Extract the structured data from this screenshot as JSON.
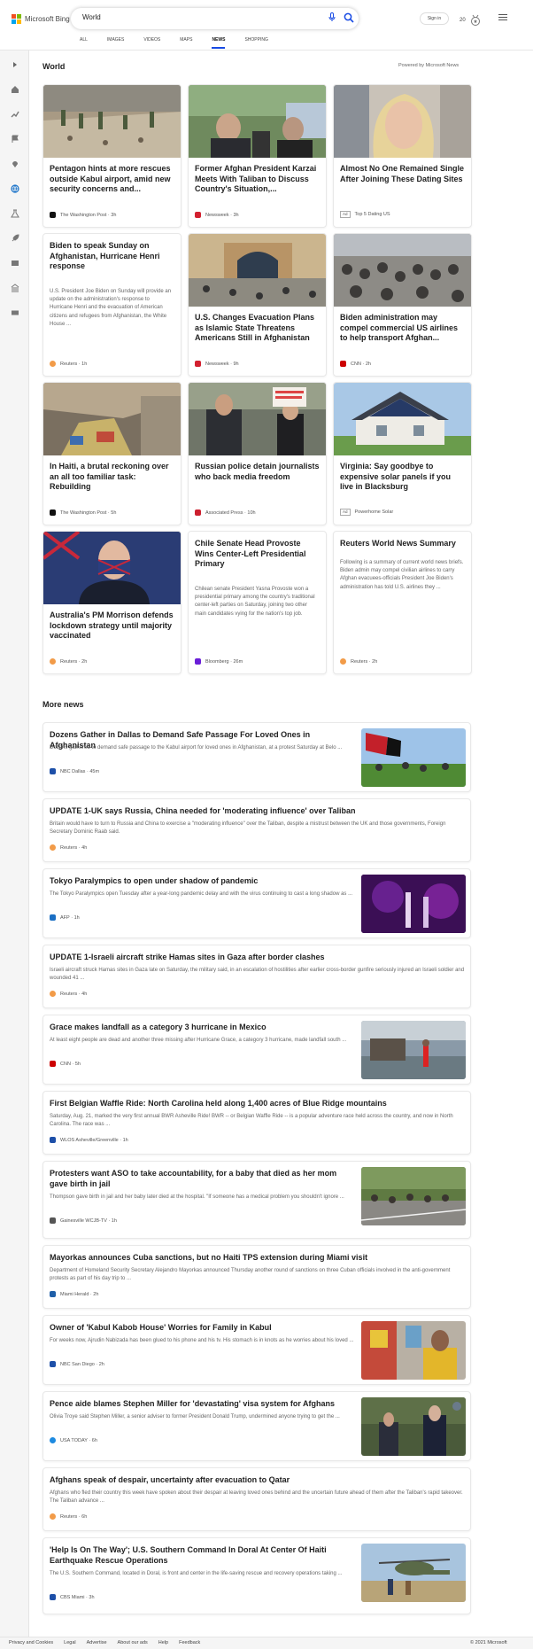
{
  "header": {
    "logo": "Microsoft Bing",
    "query": "World",
    "sign_in": "Sign in",
    "rewards": "20"
  },
  "tabs": [
    "ALL",
    "IMAGES",
    "VIDEOS",
    "MAPS",
    "NEWS",
    "SHOPPING"
  ],
  "section": {
    "title": "World",
    "powered": "Powered by Microsoft News"
  },
  "cards": [
    {
      "title": "Pentagon hints at more rescues outside Kabul airport, amid new security concerns and...",
      "source": "The Washington Post",
      "time": "3h"
    },
    {
      "title": "Former Afghan President Karzai Meets With Taliban to Discuss Country's Situation,...",
      "source": "Newsweek",
      "time": "3h"
    },
    {
      "title": "Almost No One Remained Single After Joining These Dating Sites",
      "ad": "Ad",
      "source": "Top 5 Dating US"
    },
    {
      "title": "Biden to speak Sunday on Afghanistan, Hurricane Henri response",
      "desc": "U.S. President Joe Biden on Sunday will provide an update on the administration's response to Hurricane Henri and the evacuation of American citizens and refugees from Afghanistan, the White House ...",
      "source": "Reuters",
      "time": "1h"
    },
    {
      "title": "U.S. Changes Evacuation Plans as Islamic State Threatens Americans Still in Afghanistan",
      "source": "Newsweek",
      "time": "9h"
    },
    {
      "title": "Biden administration may compel commercial US airlines to help transport Afghan...",
      "source": "CNN",
      "time": "2h"
    },
    {
      "title": "In Haiti, a brutal reckoning over an all too familiar task: Rebuilding",
      "source": "The Washington Post",
      "time": "5h"
    },
    {
      "title": "Russian police detain journalists who back media freedom",
      "source": "Associated Press",
      "time": "10h"
    },
    {
      "title": "Virginia: Say goodbye to expensive solar panels if you live in Blacksburg",
      "ad": "Ad",
      "source": "Powerhome Solar"
    },
    {
      "title": "Australia's PM Morrison defends lockdown strategy until majority vaccinated",
      "source": "Reuters",
      "time": "2h"
    },
    {
      "title": "Chile Senate Head Provoste Wins Center-Left Presidential Primary",
      "desc": "Chilean senate President Yasna Provoste won a presidential primary among the country's traditional center-left parties on Saturday, joining two other main candidates vying for the nation's top job.",
      "source": "Bloomberg",
      "time": "26m"
    },
    {
      "title": "Reuters World News Summary",
      "desc": "Following is a summary of current world news briefs. Biden admin may compel civilian airlines to carry Afghan evacuees-officials President Joe Biden's administration has told U.S. airlines they ...",
      "source": "Reuters",
      "time": "2h"
    }
  ],
  "more_title": "More news",
  "more": [
    {
      "title": "Dozens Gather in Dallas to Demand Safe Passage For Loved Ones in Afghanistan",
      "desc": "Dozens gathered to demand safe passage to the Kabul airport for loved ones in Afghanistan, at a protest Saturday at Belo ...",
      "source": "NBC Dallas",
      "time": "45m"
    },
    {
      "title": "UPDATE 1-UK says Russia, China needed for 'moderating influence' over Taliban",
      "desc": "Britain would have to turn to Russia and China to exercise a \"moderating influence\" over the Taliban, despite a mistrust between the UK and those governments, Foreign Secretary Dominic Raab said.",
      "source": "Reuters",
      "time": "4h"
    },
    {
      "title": "Tokyo Paralympics to open under shadow of pandemic",
      "desc": "The Tokyo Paralympics open Tuesday after a year-long pandemic delay and with the virus continuing to cast a long shadow as ...",
      "source": "AFP",
      "time": "1h"
    },
    {
      "title": "UPDATE 1-Israeli aircraft strike Hamas sites in Gaza after border clashes",
      "desc": "Israeli aircraft struck Hamas sites in Gaza late on Saturday, the military said, in an escalation of hostilities after earlier cross-border gunfire seriously injured an Israeli soldier and wounded 41 ...",
      "source": "Reuters",
      "time": "4h"
    },
    {
      "title": "Grace makes landfall as a category 3 hurricane in Mexico",
      "desc": "At least eight people are dead and another three missing after Hurricane Grace, a category 3 hurricane, made landfall south ...",
      "source": "CNN",
      "time": "5h"
    },
    {
      "title": "First Belgian Waffle Ride: North Carolina held along 1,400 acres of Blue Ridge mountains",
      "desc": "Saturday, Aug. 21, marked the very first annual BWR Asheville Ride! BWR -- or Belgian Waffle Ride -- is a popular adventure race held across the country, and now in North Carolina. The race was ...",
      "source": "WLOS Asheville/Greenville",
      "time": "1h"
    },
    {
      "title": "Protesters want ASO to take accountability, for a baby that died as her mom gave birth in jail",
      "desc": "Thompson gave birth in jail and her baby later died at the hospital. \"If someone has a medical problem you shouldn't ignore ...",
      "source": "Gainesville WCJB-TV",
      "time": "1h"
    },
    {
      "title": "Mayorkas announces Cuba sanctions, but no Haiti TPS extension during Miami visit",
      "desc": "Department of Homeland Security Secretary Alejandro Mayorkas announced Thursday another round of sanctions on three Cuban officials involved in the anti-government protests as part of his day trip to ...",
      "source": "Miami Herald",
      "time": "2h"
    },
    {
      "title": "Owner of 'Kabul Kabob House' Worries for Family in Kabul",
      "desc": "For weeks now, Ajrudin Nabizada has been glued to his phone and his tv. His stomach is in knots as he worries about his loved ...",
      "source": "NBC San Diego",
      "time": "2h"
    },
    {
      "title": "Pence aide blames Stephen Miller for 'devastating' visa system for Afghans",
      "desc": "Olivia Troye said Stephen Miller, a senior adviser to former President Donald Trump, undermined anyone trying to get the ...",
      "source": "USA TODAY",
      "time": "6h"
    },
    {
      "title": "Afghans speak of despair, uncertainty after evacuation to Qatar",
      "desc": "Afghans who fled their country this week have spoken about their despair at leaving loved ones behind and the uncertain future ahead of them after the Taliban's rapid takeover. The Taliban advance ...",
      "source": "Reuters",
      "time": "6h"
    },
    {
      "title": "'Help Is On The Way'; U.S. Southern Command In Doral At Center Of Haiti Earthquake Rescue Operations",
      "desc": "The U.S. Southern Command, located in Doral, is front and center in the life-saving rescue and recovery operations taking ...",
      "source": "CBS Miami",
      "time": "3h"
    }
  ],
  "footer": {
    "links": [
      "Privacy and Cookies",
      "Legal",
      "Advertise",
      "About our ads",
      "Help",
      "Feedback"
    ],
    "copyright": "© 2021 Microsoft"
  },
  "colors": {
    "accent": "#174ae4",
    "rail_active": "#1a73c9"
  }
}
